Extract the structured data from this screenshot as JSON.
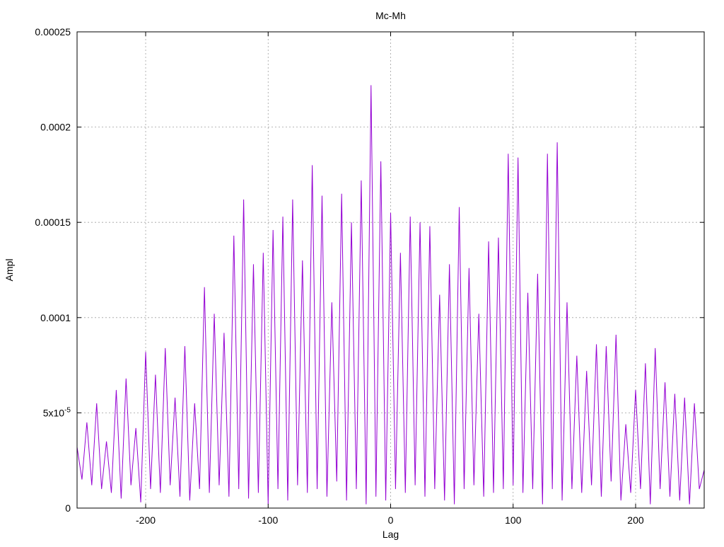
{
  "chart_data": {
    "type": "line",
    "title": "Mc-Mh",
    "xlabel": "Lag",
    "ylabel": "Ampl",
    "xlim": [
      -256,
      256
    ],
    "ylim": [
      0,
      0.00025
    ],
    "grid": true,
    "x_ticks": [
      {
        "value": -200,
        "label": "-200"
      },
      {
        "value": -100,
        "label": "-100"
      },
      {
        "value": 0,
        "label": "0"
      },
      {
        "value": 100,
        "label": "100"
      },
      {
        "value": 200,
        "label": "200"
      }
    ],
    "y_ticks": [
      {
        "value": 0,
        "label": "0"
      },
      {
        "value": 5e-05,
        "label": "5x10",
        "sup": "-5"
      },
      {
        "value": 0.0001,
        "label": "0.0001"
      },
      {
        "value": 0.00015,
        "label": "0.00015"
      },
      {
        "value": 0.0002,
        "label": "0.0002"
      },
      {
        "value": 0.00025,
        "label": "0.00025"
      }
    ],
    "series": [
      {
        "color": "#9400d3",
        "x": [
          -256,
          -252,
          -248,
          -244,
          -240,
          -236,
          -232,
          -228,
          -224,
          -220,
          -216,
          -212,
          -208,
          -204,
          -200,
          -196,
          -192,
          -188,
          -184,
          -180,
          -176,
          -172,
          -168,
          -164,
          -160,
          -156,
          -152,
          -148,
          -144,
          -140,
          -136,
          -132,
          -128,
          -124,
          -120,
          -116,
          -112,
          -108,
          -104,
          -100,
          -96,
          -92,
          -88,
          -84,
          -80,
          -76,
          -72,
          -68,
          -64,
          -60,
          -56,
          -52,
          -48,
          -44,
          -40,
          -36,
          -32,
          -28,
          -24,
          -20,
          -16,
          -12,
          -8,
          -4,
          0,
          4,
          8,
          12,
          16,
          20,
          24,
          28,
          32,
          36,
          40,
          44,
          48,
          52,
          56,
          60,
          64,
          68,
          72,
          76,
          80,
          84,
          88,
          92,
          96,
          100,
          104,
          108,
          112,
          116,
          120,
          124,
          128,
          132,
          136,
          140,
          144,
          148,
          152,
          156,
          160,
          164,
          168,
          172,
          176,
          180,
          184,
          188,
          192,
          196,
          200,
          204,
          208,
          212,
          216,
          220,
          224,
          228,
          232,
          236,
          240,
          244,
          248,
          252,
          256
        ],
        "y": [
          3.2e-05,
          1.5e-05,
          4.5e-05,
          1.2e-05,
          5.5e-05,
          1e-05,
          3.5e-05,
          8e-06,
          6.2e-05,
          5e-06,
          6.8e-05,
          1.2e-05,
          4.2e-05,
          3e-06,
          8.2e-05,
          1e-05,
          7e-05,
          8e-06,
          8.4e-05,
          1.2e-05,
          5.8e-05,
          6e-06,
          8.5e-05,
          4e-06,
          5.5e-05,
          1e-05,
          0.000116,
          8e-06,
          0.000102,
          1.2e-05,
          9.2e-05,
          6e-06,
          0.000143,
          1e-05,
          0.000162,
          5e-06,
          0.000128,
          8e-06,
          0.000134,
          2e-06,
          0.000146,
          1e-05,
          0.000153,
          4e-06,
          0.000162,
          1.2e-05,
          0.00013,
          8e-06,
          0.00018,
          1e-05,
          0.000164,
          6e-06,
          0.000108,
          1.4e-05,
          0.000165,
          4e-06,
          0.00015,
          1e-05,
          0.000172,
          2e-06,
          0.000222,
          6e-06,
          0.000182,
          4e-06,
          0.000155,
          1e-05,
          0.000134,
          8e-06,
          0.000153,
          1.2e-05,
          0.00015,
          6e-06,
          0.000148,
          1e-05,
          0.000112,
          4e-06,
          0.000128,
          2e-06,
          0.000158,
          1e-05,
          0.000126,
          1.2e-05,
          0.000102,
          6e-06,
          0.00014,
          8e-06,
          0.000142,
          1e-05,
          0.000186,
          1.2e-05,
          0.000184,
          8e-06,
          0.000113,
          1e-05,
          0.000123,
          2e-06,
          0.000186,
          1e-05,
          0.000192,
          4e-06,
          0.000108,
          1e-05,
          8e-05,
          8e-06,
          7.2e-05,
          1.2e-05,
          8.6e-05,
          6e-06,
          8.5e-05,
          1.4e-05,
          9.1e-05,
          4e-06,
          4.4e-05,
          8e-06,
          6.2e-05,
          1e-05,
          7.6e-05,
          2e-06,
          8.4e-05,
          1e-05,
          6.6e-05,
          6e-06,
          6e-05,
          4e-06,
          5.8e-05,
          2e-06,
          5.5e-05,
          1e-05,
          2e-05
        ]
      }
    ]
  }
}
